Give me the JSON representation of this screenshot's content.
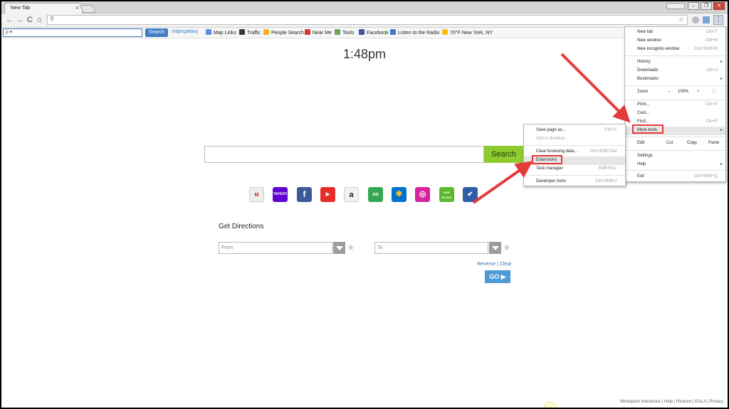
{
  "tab": {
    "title": "New Tab",
    "close": "×"
  },
  "window": {
    "min": "–",
    "max": "❐",
    "close": "✕"
  },
  "nav": {
    "back": "←",
    "forward": "→",
    "reload": "C",
    "home": "⌂",
    "search_glyph": "⚲",
    "star": "☆",
    "menu": "⋮"
  },
  "toolbar": {
    "input_placeholder": "ρ ▾",
    "search_label": "Search",
    "logo": "mapsgalaxy",
    "items": [
      {
        "label": "Map Links",
        "color": "#5a8fd6"
      },
      {
        "label": "Traffic",
        "color": "#3a3a3a"
      },
      {
        "label": "People Search",
        "color": "#f3b21a"
      },
      {
        "label": "Near Me",
        "color": "#d33a2c"
      },
      {
        "label": "Tools",
        "color": "#6aa84f"
      },
      {
        "label": "Facebook",
        "color": "#3b5998"
      },
      {
        "label": "Listen to the Radio",
        "color": "#3f7ec7"
      },
      {
        "label": "70°F New York, NY",
        "color": "#f3c21a"
      }
    ]
  },
  "page": {
    "clock": "1:48pm",
    "search_label": "Search",
    "sites": [
      {
        "name": "gmail",
        "text": "M",
        "color": "#eeeeee",
        "fg": "#c5221f"
      },
      {
        "name": "yahoo",
        "text": "YAHOO!",
        "color": "#5f01d1",
        "fg": "#ffffff"
      },
      {
        "name": "facebook",
        "text": "f",
        "color": "#3b5998",
        "fg": "#ffffff"
      },
      {
        "name": "youtube",
        "text": "▶",
        "color": "#e52d27",
        "fg": "#ffffff"
      },
      {
        "name": "amazon",
        "text": "a",
        "color": "#f2f2f2",
        "fg": "#222222"
      },
      {
        "name": "tripadvisor",
        "text": "oo",
        "color": "#34a853",
        "fg": "#ffffff"
      },
      {
        "name": "walmart",
        "text": "✱",
        "color": "#0071ce",
        "fg": "#ffc220"
      },
      {
        "name": "instagram",
        "text": "◎",
        "color": "#d6249f",
        "fg": "#ffffff"
      },
      {
        "name": "hr-block",
        "text": "H&R BLOCK",
        "color": "#5cb82e",
        "fg": "#ffffff"
      },
      {
        "name": "turbotax",
        "text": "✔",
        "color": "#2f5ea8",
        "fg": "#ffffff"
      }
    ],
    "directions_title": "Get Directions",
    "from_placeholder": "From",
    "to_placeholder": "To",
    "reverse": "Reverse",
    "link_sep": "|",
    "clear": "Clear",
    "go": "GO ▶",
    "star": "★"
  },
  "footer": {
    "links": [
      "Mindspark Interactive",
      "Help",
      "Restore",
      "EULA",
      "Privacy"
    ],
    "sep": "|"
  },
  "main_menu": {
    "new_tab": "New tab",
    "new_tab_sc": "Ctrl+T",
    "new_window": "New window",
    "new_window_sc": "Ctrl+N",
    "incognito": "New incognito window",
    "incognito_sc": "Ctrl+Shift+N",
    "history": "History",
    "downloads": "Downloads",
    "downloads_sc": "Ctrl+J",
    "bookmarks": "Bookmarks",
    "zoom": "Zoom",
    "zoom_minus": "–",
    "zoom_value": "100%",
    "zoom_plus": "+",
    "fullscreen": "⛶",
    "print": "Print...",
    "print_sc": "Ctrl+P",
    "cast": "Cast...",
    "find": "Find...",
    "find_sc": "Ctrl+F",
    "more_tools": "More tools",
    "edit": "Edit",
    "cut": "Cut",
    "copy": "Copy",
    "paste": "Paste",
    "settings": "Settings",
    "help": "Help",
    "exit": "Exit",
    "exit_sc": "Ctrl+Shift+Q",
    "arrow": "▸"
  },
  "sub_menu": {
    "save_page": "Save page as...",
    "save_page_sc": "Ctrl+S",
    "add_desktop": "Add to desktop...",
    "clear_data": "Clear browsing data...",
    "clear_data_sc": "Ctrl+Shift+Del",
    "extensions": "Extensions",
    "task_manager": "Task manager",
    "task_manager_sc": "Shift+Esc",
    "dev_tools": "Developer tools",
    "dev_tools_sc": "Ctrl+Shift+I"
  },
  "colors": {
    "annotation_red": "#e23b3b",
    "search_green": "#8fca2e",
    "go_blue": "#4a9bd6"
  }
}
